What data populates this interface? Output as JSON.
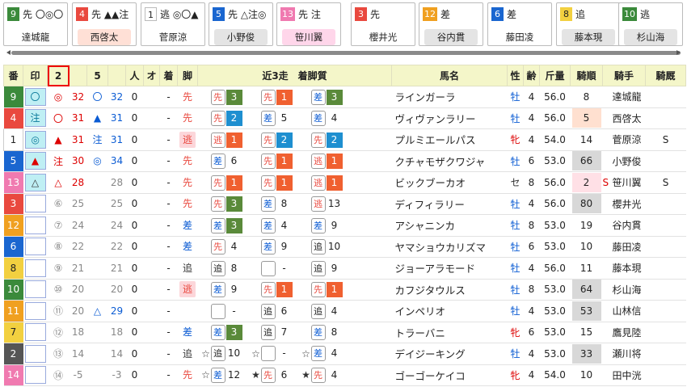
{
  "top_cards": [
    {
      "num": "9",
      "marks": "先 〇◎〇",
      "jockey": "達城龍",
      "num_color": "#3b8a3b",
      "bg": ""
    },
    {
      "num": "4",
      "marks": "先 ▲▲注",
      "jockey": "西啓太",
      "num_color": "#e9493f",
      "bg": "#ffe0d6"
    },
    {
      "num": "1",
      "marks": "逃 ◎〇▲",
      "jockey": "菅原涼",
      "num_color": "#ffffff",
      "bg": ""
    },
    {
      "num": "5",
      "marks": "先 △注◎",
      "jockey": "小野俊",
      "num_color": "#1a66d0",
      "bg": "#e4e4e4"
    },
    {
      "num": "13",
      "marks": "先 注",
      "jockey": "笹川翼",
      "num_color": "#f07ab0",
      "bg": "#ffd6ea"
    },
    {
      "num": "3",
      "marks": "先",
      "jockey": "櫻井光",
      "num_color": "#e9493f",
      "bg": ""
    },
    {
      "num": "12",
      "marks": "差",
      "jockey": "谷内貫",
      "num_color": "#f0a020",
      "bg": "#e4e4e4"
    },
    {
      "num": "6",
      "marks": "差",
      "jockey": "藤田凌",
      "num_color": "#1a66d0",
      "bg": ""
    },
    {
      "num": "8",
      "marks": "追",
      "jockey": "藤本現",
      "num_color": "#f2d040",
      "bg": "#e4e4e4"
    },
    {
      "num": "10",
      "marks": "逃",
      "jockey": "杉山海",
      "num_color": "#3b8a3b",
      "bg": "#e4e4e4"
    }
  ],
  "headers": {
    "ban": "番",
    "mark": "印",
    "c2": "2",
    "c3": "",
    "c5": "5",
    "c6": "",
    "nin": "人",
    "o": "オ",
    "chaku": "着",
    "ashi": "脚",
    "recent": "近3走　着脚質",
    "name": "馬名",
    "sex": "性",
    "age": "齢",
    "kin": "斤量",
    "kijun": "騎順",
    "jockey": "騎手",
    "kyu": "騎厩"
  },
  "rows": [
    {
      "ban": "9",
      "bc": "#3b8a3b",
      "mk": "〇",
      "mon": true,
      "m2": "◎",
      "v2": "32",
      "m5": "〇",
      "v5": "32",
      "nin": "0",
      "chaku": "-",
      "ashi": "先",
      "ap": false,
      "r": [
        [
          "",
          "先",
          "3",
          "g"
        ],
        [
          "",
          "先",
          "1",
          "o"
        ],
        [
          "",
          "差",
          "3",
          "g"
        ]
      ],
      "name": "ラインガーラ",
      "sex": "牡",
      "age": "4",
      "kin": "56.0",
      "kj": "8",
      "kjbg": "",
      "jk": "達城龍",
      "f1": "",
      "f2": ""
    },
    {
      "ban": "4",
      "bc": "#e9493f",
      "mk": "注",
      "mon": true,
      "m2": "〇",
      "v2": "31",
      "m5": "▲",
      "v5": "31",
      "nin": "0",
      "chaku": "-",
      "ashi": "先",
      "ap": false,
      "r": [
        [
          "",
          "先",
          "2",
          "b"
        ],
        [
          "",
          "差",
          "5",
          ""
        ],
        [
          "",
          "差",
          "4",
          ""
        ]
      ],
      "name": "ヴィヴァンラリー",
      "sex": "牡",
      "age": "4",
      "kin": "56.0",
      "kj": "5",
      "kjbg": "peach",
      "jk": "西啓太",
      "f1": "",
      "f2": ""
    },
    {
      "ban": "1",
      "bc": "#ffffff",
      "mk": "◎",
      "mon": true,
      "m2": "▲",
      "v2": "31",
      "m5": "注",
      "v5": "31",
      "nin": "0",
      "chaku": "-",
      "ashi": "逃",
      "ap": true,
      "r": [
        [
          "",
          "逃",
          "1",
          "o"
        ],
        [
          "",
          "先",
          "2",
          "b"
        ],
        [
          "",
          "先",
          "2",
          "b"
        ]
      ],
      "name": "プルミエールパス",
      "sex": "牝",
      "age": "4",
      "kin": "54.0",
      "kj": "14",
      "kjbg": "",
      "jk": "菅原涼",
      "f1": "",
      "f2": "S"
    },
    {
      "ban": "5",
      "bc": "#1a66d0",
      "mk": "▲",
      "mon": true,
      "m2": "注",
      "v2": "30",
      "m5": "◎",
      "v5": "34",
      "nin": "0",
      "chaku": "-",
      "ashi": "先",
      "ap": false,
      "r": [
        [
          "",
          "差",
          "6",
          ""
        ],
        [
          "",
          "先",
          "1",
          "o"
        ],
        [
          "",
          "逃",
          "1",
          "o"
        ]
      ],
      "name": "クチャモザクワジャ",
      "sex": "牡",
      "age": "6",
      "kin": "53.0",
      "kj": "66",
      "kjbg": "gray",
      "jk": "小野俊",
      "f1": "",
      "f2": ""
    },
    {
      "ban": "13",
      "bc": "#f07ab0",
      "mk": "△",
      "mon": true,
      "m2": "△",
      "v2": "28",
      "m5": "",
      "v5": "28",
      "nin": "0",
      "chaku": "-",
      "ashi": "先",
      "ap": false,
      "r": [
        [
          "",
          "先",
          "1",
          "o"
        ],
        [
          "",
          "先",
          "1",
          "o"
        ],
        [
          "",
          "逃",
          "1",
          "o"
        ]
      ],
      "name": "ビックブーカオ",
      "sex": "セ",
      "age": "8",
      "kin": "56.0",
      "kj": "2",
      "kjbg": "pink",
      "jk": "笹川翼",
      "f1": "S",
      "f2": "S"
    },
    {
      "ban": "3",
      "bc": "#e9493f",
      "mk": "",
      "mon": false,
      "m2": "⑥",
      "v2": "25",
      "m5": "",
      "v5": "25",
      "nin": "0",
      "chaku": "-",
      "ashi": "先",
      "ap": false,
      "r": [
        [
          "",
          "先",
          "3",
          "g"
        ],
        [
          "",
          "差",
          "8",
          ""
        ],
        [
          "",
          "逃",
          "13",
          ""
        ]
      ],
      "name": "ディフィラリー",
      "sex": "牡",
      "age": "4",
      "kin": "56.0",
      "kj": "80",
      "kjbg": "gray",
      "jk": "櫻井光",
      "f1": "",
      "f2": ""
    },
    {
      "ban": "12",
      "bc": "#f0a020",
      "mk": "",
      "mon": false,
      "m2": "⑦",
      "v2": "24",
      "m5": "",
      "v5": "24",
      "nin": "0",
      "chaku": "-",
      "ashi": "差",
      "ap": false,
      "r": [
        [
          "",
          "差",
          "3",
          "g"
        ],
        [
          "",
          "差",
          "4",
          ""
        ],
        [
          "",
          "差",
          "9",
          ""
        ]
      ],
      "name": "アシャニンカ",
      "sex": "牡",
      "age": "8",
      "kin": "53.0",
      "kj": "19",
      "kjbg": "",
      "jk": "谷内貫",
      "f1": "",
      "f2": ""
    },
    {
      "ban": "6",
      "bc": "#1a66d0",
      "mk": "",
      "mon": false,
      "m2": "⑧",
      "v2": "22",
      "m5": "",
      "v5": "22",
      "nin": "0",
      "chaku": "-",
      "ashi": "差",
      "ap": false,
      "r": [
        [
          "",
          "先",
          "4",
          ""
        ],
        [
          "",
          "差",
          "9",
          ""
        ],
        [
          "",
          "追",
          "10",
          ""
        ]
      ],
      "name": "ヤマショウカリズマ",
      "sex": "牡",
      "age": "6",
      "kin": "53.0",
      "kj": "10",
      "kjbg": "",
      "jk": "藤田凌",
      "f1": "",
      "f2": ""
    },
    {
      "ban": "8",
      "bc": "#f2d040",
      "mk": "",
      "mon": false,
      "m2": "⑨",
      "v2": "21",
      "m5": "",
      "v5": "21",
      "nin": "0",
      "chaku": "-",
      "ashi": "追",
      "ap": false,
      "r": [
        [
          "",
          "追",
          "8",
          ""
        ],
        [
          "",
          "",
          "-",
          ""
        ],
        [
          "",
          "追",
          "9",
          ""
        ]
      ],
      "name": "ジョーアラモード",
      "sex": "牡",
      "age": "4",
      "kin": "56.0",
      "kj": "11",
      "kjbg": "",
      "jk": "藤本現",
      "f1": "",
      "f2": ""
    },
    {
      "ban": "10",
      "bc": "#3b8a3b",
      "mk": "",
      "mon": false,
      "m2": "⑩",
      "v2": "20",
      "m5": "",
      "v5": "20",
      "nin": "0",
      "chaku": "-",
      "ashi": "逃",
      "ap": true,
      "r": [
        [
          "",
          "差",
          "9",
          ""
        ],
        [
          "",
          "先",
          "1",
          "o"
        ],
        [
          "",
          "先",
          "1",
          "o"
        ]
      ],
      "name": "カフジタウルス",
      "sex": "牡",
      "age": "8",
      "kin": "53.0",
      "kj": "64",
      "kjbg": "gray",
      "jk": "杉山海",
      "f1": "",
      "f2": ""
    },
    {
      "ban": "11",
      "bc": "#f0a020",
      "mk": "",
      "mon": false,
      "m2": "⑪",
      "v2": "20",
      "m5": "△",
      "v5": "29",
      "nin": "0",
      "chaku": "-",
      "ashi": "",
      "ap": false,
      "r": [
        [
          "",
          "",
          "-",
          ""
        ],
        [
          "",
          "追",
          "6",
          ""
        ],
        [
          "",
          "追",
          "4",
          ""
        ]
      ],
      "name": "インペリオ",
      "sex": "牡",
      "age": "4",
      "kin": "53.0",
      "kj": "53",
      "kjbg": "gray",
      "jk": "山林信",
      "f1": "",
      "f2": ""
    },
    {
      "ban": "7",
      "bc": "#f2d040",
      "mk": "",
      "mon": false,
      "m2": "⑫",
      "v2": "18",
      "m5": "",
      "v5": "18",
      "nin": "0",
      "chaku": "-",
      "ashi": "差",
      "ap": false,
      "r": [
        [
          "",
          "差",
          "3",
          "g"
        ],
        [
          "",
          "追",
          "7",
          ""
        ],
        [
          "",
          "差",
          "8",
          ""
        ]
      ],
      "name": "トラーバニ",
      "sex": "牝",
      "age": "6",
      "kin": "53.0",
      "kj": "15",
      "kjbg": "",
      "jk": "鷹見陸",
      "f1": "",
      "f2": ""
    },
    {
      "ban": "2",
      "bc": "#555555",
      "mk": "",
      "mon": false,
      "m2": "⑬",
      "v2": "14",
      "m5": "",
      "v5": "14",
      "nin": "0",
      "chaku": "-",
      "ashi": "追",
      "ap": false,
      "r": [
        [
          "☆",
          "追",
          "10",
          ""
        ],
        [
          "☆",
          "",
          "-",
          ""
        ],
        [
          "☆",
          "差",
          "4",
          ""
        ]
      ],
      "name": "デイジーキング",
      "sex": "牡",
      "age": "4",
      "kin": "53.0",
      "kj": "33",
      "kjbg": "gray",
      "jk": "瀬川将",
      "f1": "",
      "f2": ""
    },
    {
      "ban": "14",
      "bc": "#f07ab0",
      "mk": "",
      "mon": false,
      "m2": "⑭",
      "v2": "-5",
      "m5": "",
      "v5": "-3",
      "nin": "0",
      "chaku": "-",
      "ashi": "先",
      "ap": false,
      "r": [
        [
          "☆",
          "差",
          "12",
          ""
        ],
        [
          "★",
          "先",
          "6",
          ""
        ],
        [
          "★",
          "先",
          "4",
          ""
        ]
      ],
      "name": "ゴーゴーケイコ",
      "sex": "牝",
      "age": "4",
      "kin": "54.0",
      "kj": "10",
      "kjbg": "",
      "jk": "田中洸",
      "f1": "",
      "f2": ""
    }
  ]
}
